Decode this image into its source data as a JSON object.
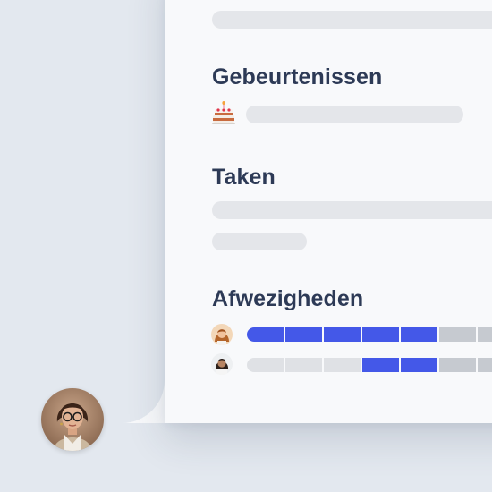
{
  "sections": {
    "events": {
      "title": "Gebeurtenissen",
      "icon": "birthday-cake-icon"
    },
    "tasks": {
      "title": "Taken"
    },
    "absences": {
      "title": "Afwezigheden",
      "rows": [
        {
          "person": "woman-avatar-1",
          "blocks": [
            "on",
            "on",
            "on",
            "on",
            "on",
            "after",
            "after"
          ]
        },
        {
          "person": "woman-avatar-2",
          "blocks": [
            "off",
            "off",
            "off",
            "on",
            "on",
            "after",
            "after"
          ]
        }
      ]
    }
  },
  "user": {
    "avatar": "user-avatar"
  },
  "colors": {
    "background": "#e3e8ef",
    "panel": "#f8f9fb",
    "heading": "#2d3a56",
    "placeholder": "#e4e6ea",
    "absence_active": "#4458e8",
    "absence_future": "#c6cad0"
  }
}
